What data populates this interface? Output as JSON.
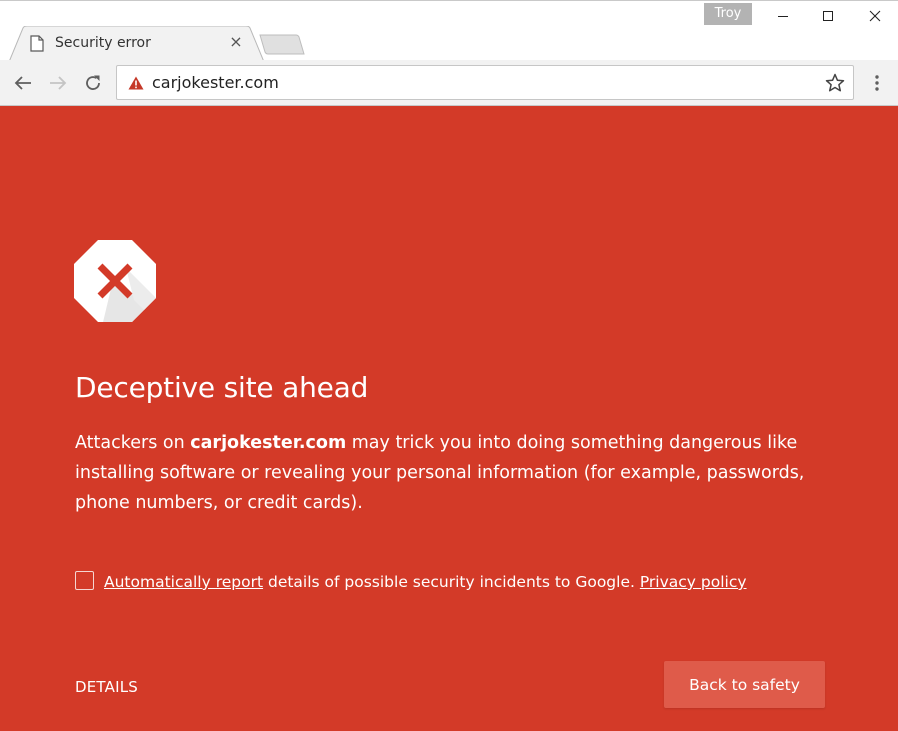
{
  "window": {
    "profile_name": "Troy"
  },
  "tab": {
    "title": "Security error",
    "close_glyph": "×"
  },
  "omnibox": {
    "url": "carjokester.com"
  },
  "interstitial": {
    "heading": "Deceptive site ahead",
    "body_prefix": "Attackers on ",
    "body_domain": "carjokester.com",
    "body_suffix": " may trick you into doing something dangerous like installing software or revealing your personal information (for example, passwords, phone numbers, or credit cards).",
    "report_link": "Automatically report",
    "report_text": " details of possible security incidents to Google. ",
    "privacy_link": "Privacy policy",
    "details_label": "DETAILS",
    "back_button_label": "Back to safety"
  },
  "colors": {
    "danger_background": "#d33a28",
    "button_background": "#df5b4a",
    "icon_cross": "#d33a28"
  },
  "icons": {
    "tab_favicon": "page-icon",
    "omnibox_warning": "warning-triangle-icon",
    "bookmark": "star-icon",
    "menu": "three-dots-vertical-icon",
    "stop": "octagon-cross-icon"
  }
}
